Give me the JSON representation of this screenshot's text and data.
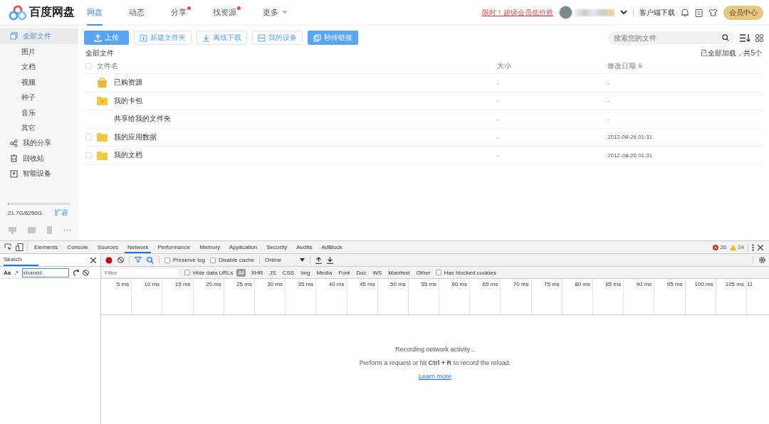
{
  "header": {
    "logo": "百度网盘",
    "nav": [
      {
        "label": "网盘",
        "selected": true,
        "badge": false
      },
      {
        "label": "动态",
        "selected": false,
        "badge": false
      },
      {
        "label": "分享",
        "selected": false,
        "badge": true
      },
      {
        "label": "找资源",
        "selected": false,
        "badge": true
      },
      {
        "label": "更多",
        "selected": false,
        "badge": false
      }
    ],
    "promo": "限时！超级会员低价抢",
    "client_download": "客户端下载",
    "vip_button": "会员中心"
  },
  "sidebar": {
    "items": [
      {
        "label": "全部文件",
        "selected": true,
        "children": [
          {
            "label": "图片",
            "selected": false
          },
          {
            "label": "文档",
            "selected": false
          },
          {
            "label": "视频",
            "selected": false
          },
          {
            "label": "种子",
            "selected": false
          },
          {
            "label": "音乐",
            "selected": false
          },
          {
            "label": "其它",
            "selected": false
          }
        ]
      },
      {
        "label": "我的分享",
        "selected": false
      },
      {
        "label": "回收站",
        "selected": false
      },
      {
        "label": "智能设备",
        "selected": false
      }
    ],
    "storage": {
      "level": 0.0035,
      "text": "21.7G/6250G",
      "expand": "扩容"
    }
  },
  "toolbar": {
    "buttons": [
      {
        "label": "上传",
        "kind": "primary"
      },
      {
        "label": "新建文件夹",
        "kind": "outline"
      },
      {
        "label": "离线下载",
        "kind": "outline"
      },
      {
        "label": "我的设备",
        "kind": "outline"
      },
      {
        "label": "秒传链接",
        "kind": "primary"
      }
    ],
    "search": {
      "placeholder": "搜索您的文件"
    }
  },
  "breadcrumb": "全部文件",
  "load_status": "已全部加载，共5个",
  "table": {
    "columns": [
      "文件名",
      "大小",
      "修改日期"
    ],
    "select_all_checked": false,
    "rows": [
      {
        "name": "已购资源",
        "kind": "purchased",
        "size": "-",
        "modified": "-"
      },
      {
        "name": "我的卡包",
        "kind": "system_folder",
        "size": "-",
        "modified": "-"
      },
      {
        "name": "共享给我的文件夹",
        "kind": "shared",
        "size": "-",
        "modified": "-"
      },
      {
        "name": "我的应用数据",
        "kind": "folder",
        "checked": false,
        "size": "-",
        "modified": "2012-08-26 01:31"
      },
      {
        "name": "我的文档",
        "kind": "folder",
        "checked": false,
        "size": "-",
        "modified": "2012-08-26 01:31"
      }
    ]
  },
  "devtools": {
    "tabs": [
      {
        "label": "Elements",
        "selected": false
      },
      {
        "label": "Console",
        "selected": false
      },
      {
        "label": "Sources",
        "selected": false
      },
      {
        "label": "Network",
        "selected": true
      },
      {
        "label": "Performance",
        "selected": false
      },
      {
        "label": "Memory",
        "selected": false
      },
      {
        "label": "Application",
        "selected": false
      },
      {
        "label": "Security",
        "selected": false
      },
      {
        "label": "Audits",
        "selected": false
      },
      {
        "label": "AdBlock",
        "selected": false
      }
    ],
    "errors": "26",
    "warnings": "24",
    "search_panel": {
      "title": "Search",
      "case_toggle": "Aa",
      "regex_toggle": ".*",
      "query": "shareid"
    },
    "network": {
      "preserve_log": {
        "label": "Preserve log",
        "checked": false
      },
      "disable_cache": {
        "label": "Disable cache",
        "checked": false
      },
      "throttling": "Online",
      "filter_placeholder": "Filter",
      "hide_data_urls": {
        "label": "Hide data URLs",
        "checked": false
      },
      "types": [
        {
          "label": "All",
          "selected": true
        },
        {
          "label": "XHR",
          "selected": false
        },
        {
          "label": "JS",
          "selected": false
        },
        {
          "label": "CSS",
          "selected": false
        },
        {
          "label": "Img",
          "selected": false
        },
        {
          "label": "Media",
          "selected": false
        },
        {
          "label": "Font",
          "selected": false
        },
        {
          "label": "Doc",
          "selected": false
        },
        {
          "label": "WS",
          "selected": false
        },
        {
          "label": "Manifest",
          "selected": false
        },
        {
          "label": "Other",
          "selected": false
        }
      ],
      "blocked_cookies": {
        "label": "Has blocked cookies",
        "checked": false
      },
      "ticks": [
        "5 ms",
        "10 ms",
        "15 ms",
        "20 ms",
        "25 ms",
        "30 ms",
        "35 ms",
        "40 ms",
        "45 ms",
        "50 ms",
        "55 ms",
        "60 ms",
        "65 ms",
        "70 ms",
        "75 ms",
        "80 ms",
        "85 ms",
        "90 ms",
        "95 ms",
        "100 ms",
        "105 ms",
        "11"
      ],
      "empty_title": "Recording network activity...",
      "empty_hint": "Perform a request or hit **Ctrl + R** to record the reload.",
      "learn_more": "Learn more"
    }
  }
}
